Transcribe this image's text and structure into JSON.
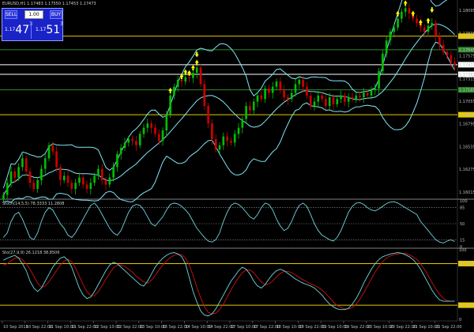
{
  "symbol_info": "EURUSD,H1  1.17483 1.17550 1.17453 1.17473",
  "trade_panel": {
    "sell_label": "SELL",
    "buy_label": "BUY",
    "lot": "1.00",
    "sell_prefix": "1.17",
    "sell_big": "47",
    "sell_sup": "3",
    "buy_prefix": "1.17",
    "buy_big": "51",
    "buy_sup": "3"
  },
  "colors": {
    "bullish": "#00c000",
    "bearish": "#d00000",
    "bands": "#7fe8f5",
    "hline_yellow": "#e8c800",
    "hline_green": "#2e8b2e",
    "hline_white": "#ffffff",
    "stoch_main": "#6fd6e0",
    "stoch_signal": "#d01010",
    "arrows": "#ffff00"
  },
  "chart_data": [
    {
      "type": "candlestick",
      "title": "EURUSD,H1",
      "y_ticks": [
        "1.18095",
        "1.17835",
        "1.17575",
        "1.17315",
        "1.17055",
        "1.16795",
        "1.16535",
        "1.16275",
        "1.16015"
      ],
      "price_labels": [
        {
          "value": "1.17800",
          "color": "yellow",
          "style": "box"
        },
        {
          "value": "1.17645",
          "color": "green",
          "style": "box"
        },
        {
          "value": "1.17473",
          "color": "white",
          "style": "box"
        },
        {
          "value": "1.17363",
          "color": "white",
          "style": "box"
        },
        {
          "value": "1.17185",
          "color": "green",
          "style": "box"
        },
        {
          "value": "1.16900",
          "color": "yellow",
          "style": "box"
        }
      ],
      "horizontal_lines": [
        {
          "value": 1.178,
          "color": "yellow"
        },
        {
          "value": 1.17645,
          "color": "green"
        },
        {
          "value": 1.17473,
          "color": "white"
        },
        {
          "value": 1.17363,
          "color": "white"
        },
        {
          "value": 1.17185,
          "color": "green"
        },
        {
          "value": 1.169,
          "color": "yellow"
        }
      ],
      "ylim": [
        1.1595,
        1.1816
      ],
      "series_close": [
        1.1598,
        1.1612,
        1.1625,
        1.1618,
        1.163,
        1.164,
        1.1625,
        1.1612,
        1.1605,
        1.1615,
        1.1628,
        1.164,
        1.1655,
        1.1648,
        1.163,
        1.1615,
        1.162,
        1.1612,
        1.1605,
        1.1612,
        1.1618,
        1.161,
        1.1605,
        1.1612,
        1.162,
        1.1628,
        1.1615,
        1.161,
        1.1618,
        1.163,
        1.1645,
        1.1652,
        1.1658,
        1.1662,
        1.166,
        1.1655,
        1.1668,
        1.1675,
        1.168,
        1.1675,
        1.1668,
        1.166,
        1.1672,
        1.169,
        1.1712,
        1.1722,
        1.173,
        1.1728,
        1.1733,
        1.1732,
        1.1738,
        1.1744,
        1.1725,
        1.17,
        1.168,
        1.1662,
        1.165,
        1.1655,
        1.1665,
        1.166,
        1.1658,
        1.1668,
        1.1675,
        1.1685,
        1.17,
        1.1695,
        1.1705,
        1.1712,
        1.1708,
        1.172,
        1.1715,
        1.1722,
        1.1728,
        1.1718,
        1.171,
        1.1708,
        1.1715,
        1.1725,
        1.173,
        1.1722,
        1.1712,
        1.17,
        1.1705,
        1.1712,
        1.1708,
        1.17,
        1.171,
        1.1702,
        1.1708,
        1.1712,
        1.1705,
        1.171,
        1.1708,
        1.1712,
        1.171,
        1.1715,
        1.1712,
        1.1718,
        1.172,
        1.174,
        1.176,
        1.1775,
        1.1785,
        1.179,
        1.18,
        1.1808,
        1.1812,
        1.1806,
        1.18,
        1.1795,
        1.179,
        1.1785,
        1.1792,
        1.1795,
        1.178,
        1.177,
        1.1762,
        1.1758,
        1.175,
        1.1747
      ],
      "up_arrows_near_index": [
        44,
        47,
        48,
        49,
        50,
        51,
        104,
        106,
        108,
        110,
        112
      ],
      "down_arrows_near_index": [
        51,
        113
      ]
    },
    {
      "type": "line",
      "title": "Stoch(14,5,5) 78.3333 11.2808",
      "y_ticks": [
        "100",
        "85",
        "50",
        "15",
        "0"
      ],
      "levels": [
        85,
        50,
        15
      ],
      "ylim": [
        0,
        100
      ],
      "series": [
        {
          "name": "main",
          "values": [
            20,
            30,
            55,
            70,
            75,
            60,
            40,
            20,
            15,
            30,
            55,
            75,
            85,
            80,
            65,
            50,
            40,
            25,
            20,
            30,
            45,
            60,
            75,
            90,
            95,
            85,
            70,
            55,
            40,
            30,
            25,
            35,
            55,
            75,
            88,
            92,
            90,
            80,
            65,
            50,
            45,
            55,
            65,
            80,
            92,
            95,
            93,
            88,
            80,
            70,
            55,
            40,
            30,
            20,
            12,
            10,
            15,
            30,
            55,
            75,
            90,
            95,
            92,
            85,
            75,
            65,
            60,
            70,
            85,
            95,
            92,
            80,
            60,
            45,
            35,
            40,
            55,
            75,
            90,
            95,
            88,
            70,
            50,
            35,
            25,
            20,
            15,
            12,
            20,
            35,
            55,
            75,
            88,
            95,
            96,
            92,
            85,
            80,
            78,
            82,
            88,
            94,
            97,
            98,
            95,
            90,
            85,
            80,
            75,
            70,
            55,
            45,
            35,
            25,
            15,
            10,
            8,
            12,
            15,
            11
          ]
        }
      ]
    },
    {
      "type": "line",
      "title": "Sto(27,9,9) 26.1218 38.8506",
      "y_ticks": [
        "100",
        "80.1692",
        "20.3672",
        "0"
      ],
      "levels": [
        80.1692,
        20.3672
      ],
      "ylim": [
        0,
        100
      ],
      "series": [
        {
          "name": "main",
          "values": [
            85,
            88,
            90,
            92,
            88,
            80,
            70,
            55,
            45,
            40,
            45,
            55,
            65,
            75,
            82,
            88,
            90,
            85,
            75,
            60,
            45,
            35,
            30,
            32,
            40,
            50,
            60,
            70,
            78,
            82,
            80,
            75,
            70,
            65,
            60,
            55,
            50,
            48,
            55,
            65,
            75,
            82,
            88,
            92,
            95,
            96,
            94,
            90,
            80,
            60,
            40,
            25,
            12,
            6,
            5,
            8,
            15,
            25,
            35,
            45,
            55,
            62,
            70,
            75,
            72,
            65,
            55,
            48,
            45,
            50,
            58,
            65,
            70,
            72,
            70,
            66,
            62,
            58,
            55,
            52,
            50,
            48,
            45,
            40,
            35,
            28,
            22,
            18,
            15,
            14,
            14,
            16,
            22,
            30,
            40,
            52,
            62,
            72,
            80,
            86,
            90,
            92,
            94,
            95,
            96,
            95,
            93,
            90,
            86,
            80,
            72,
            62,
            52,
            42,
            34,
            28,
            26,
            26,
            26,
            26
          ]
        },
        {
          "name": "signal",
          "values": [
            78,
            80,
            84,
            88,
            89,
            86,
            80,
            72,
            62,
            52,
            46,
            48,
            54,
            62,
            70,
            78,
            84,
            86,
            83,
            74,
            62,
            50,
            40,
            34,
            34,
            40,
            48,
            58,
            66,
            74,
            78,
            78,
            76,
            72,
            68,
            62,
            58,
            54,
            52,
            56,
            63,
            71,
            78,
            84,
            89,
            92,
            94,
            93,
            88,
            78,
            63,
            46,
            31,
            18,
            10,
            8,
            9,
            14,
            22,
            32,
            42,
            52,
            60,
            67,
            71,
            71,
            67,
            60,
            54,
            50,
            51,
            55,
            61,
            66,
            69,
            69,
            67,
            64,
            60,
            57,
            54,
            51,
            49,
            46,
            42,
            37,
            31,
            25,
            20,
            17,
            15,
            15,
            17,
            22,
            29,
            38,
            48,
            58,
            68,
            76,
            83,
            88,
            91,
            93,
            94,
            95,
            95,
            93,
            90,
            86,
            80,
            72,
            63,
            53,
            44,
            36,
            30,
            27,
            26,
            26
          ]
        }
      ]
    }
  ],
  "time_labels": [
    "10 Sep 2018",
    "10 Sep 22:00",
    "11 Sep 10:00",
    "11 Sep 22:00",
    "12 Sep 10:00",
    "12 Sep 22:00",
    "13 Sep 10:00",
    "13 Sep 22:00",
    "14 Sep 10:00",
    "14 Sep 22:00",
    "17 Sep 10:00",
    "17 Sep 22:00",
    "18 Sep 10:00",
    "18 Sep 22:00",
    "19 Sep 10:00",
    "19 Sep 22:00",
    "20 Sep 10:00",
    "20 Sep 22:00",
    "21 Sep 10:00",
    "21 Sep 22:00"
  ]
}
